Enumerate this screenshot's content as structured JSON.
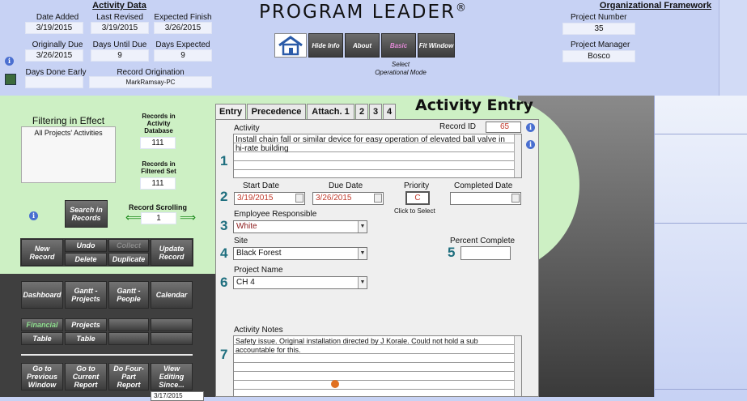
{
  "activity_data": {
    "title": "Activity Data",
    "date_added_label": "Date Added",
    "date_added": "3/19/2015",
    "last_revised_label": "Last Revised",
    "last_revised": "3/19/2015",
    "expected_finish_label": "Expected Finish",
    "expected_finish": "3/26/2015",
    "originally_due_label": "Originally Due",
    "originally_due": "3/26/2015",
    "days_until_due_label": "Days Until Due",
    "days_until_due": "9",
    "days_expected_label": "Days Expected",
    "days_expected": "9",
    "days_done_early_label": "Days Done Early",
    "days_done_early": "",
    "record_origination_label": "Record Origination",
    "record_origination": "MarkRamsay-PC"
  },
  "app": {
    "title": "PROGRAM LEADER",
    "reg_mark": "®",
    "nav": [
      "Hide Info",
      "About",
      "Basic",
      "Fit Window"
    ],
    "select_mode_line1": "Select",
    "select_mode_line2": "Operational Mode"
  },
  "org": {
    "title": "Organizational Framework",
    "project_number_label": "Project Number",
    "project_number": "35",
    "project_manager_label": "Project Manager",
    "project_manager": "Bosco"
  },
  "filter": {
    "title": "Filtering in Effect",
    "value": "All Projects' Activities",
    "records_db_label": "Records in Activity Database",
    "records_db": "111",
    "records_filtered_label": "Records in Filtered Set",
    "records_filtered": "111",
    "search_label": "Search in Records",
    "scrolling_label": "Record Scrolling",
    "scrolling_value": "1",
    "prev_arrow": "⟸",
    "next_arrow": "⟹"
  },
  "record_buttons": {
    "new": "New Record",
    "undo": "Undo",
    "delete": "Delete",
    "collect": "Collect",
    "duplicate": "Duplicate",
    "update": "Update Record"
  },
  "nav_buttons": {
    "dashboard": "Dashboard",
    "gantt_projects": "Gantt - Projects",
    "gantt_people": "Gantt - People",
    "calendar": "Calendar",
    "financial": "Financial",
    "projects": "Projects",
    "table1": "Table",
    "table2": "Table",
    "prev_window": "Go to Previous Window",
    "current_report": "Go to Current Report",
    "four_part": "Do Four-Part Report",
    "view_editing": "View Editing Since...",
    "since_date": "3/17/2015"
  },
  "tabs": [
    "Entry",
    "Precedence",
    "Attach. 1",
    "2",
    "3",
    "4"
  ],
  "entry": {
    "heading": "Activity Entry",
    "activity_label": "Activity",
    "record_id_label": "Record ID",
    "record_id": "65",
    "activity_text": "Install chain fall or similar device for easy operation of elevated ball valve in hi-rate building",
    "start_date_label": "Start Date",
    "start_date": "3/19/2015",
    "due_date_label": "Due Date",
    "due_date": "3/26/2015",
    "priority_label": "Priority",
    "priority": "C",
    "priority_hint": "Click to Select",
    "completed_date_label": "Completed Date",
    "completed_date": "",
    "employee_label": "Employee Responsible",
    "employee": "White",
    "site_label": "Site",
    "site": "Black Forest",
    "percent_label": "Percent Complete",
    "percent": "",
    "project_label": "Project Name",
    "project": "CH 4",
    "notes_label": "Activity Notes",
    "notes_text": "Safety issue.  Original installation directed by J Korale.  Could not hold a sub accountable for this.",
    "step_numbers": [
      "1",
      "2",
      "3",
      "4",
      "5",
      "6",
      "7"
    ]
  },
  "colors": {
    "header_bg": "#c7d2f4",
    "green_panel": "#cdf0c4",
    "dark_panel": "#3f3f3f",
    "accent_red": "#c0392b",
    "step_teal": "#1f6f7f"
  }
}
